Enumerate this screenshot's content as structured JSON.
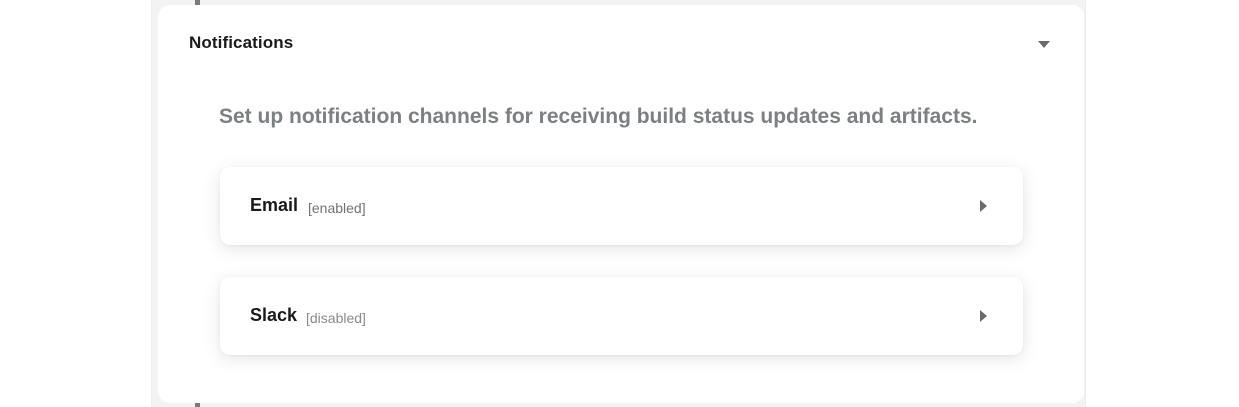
{
  "notifications": {
    "title": "Notifications",
    "toggle_icon": "chevron-down-icon",
    "description": "Set up notification channels for receiving build status updates and artifacts.",
    "channels": [
      {
        "name": "Email",
        "status": "[enabled]",
        "icon": "chevron-right-icon"
      },
      {
        "name": "Slack",
        "status": "[disabled]",
        "icon": "chevron-right-icon"
      }
    ]
  },
  "colors": {
    "title": "#1a1a1a",
    "description": "#7c8082",
    "status": "#7b7b7b",
    "frame_background": "#f3f3f3",
    "icon": "#6b6b6b"
  }
}
